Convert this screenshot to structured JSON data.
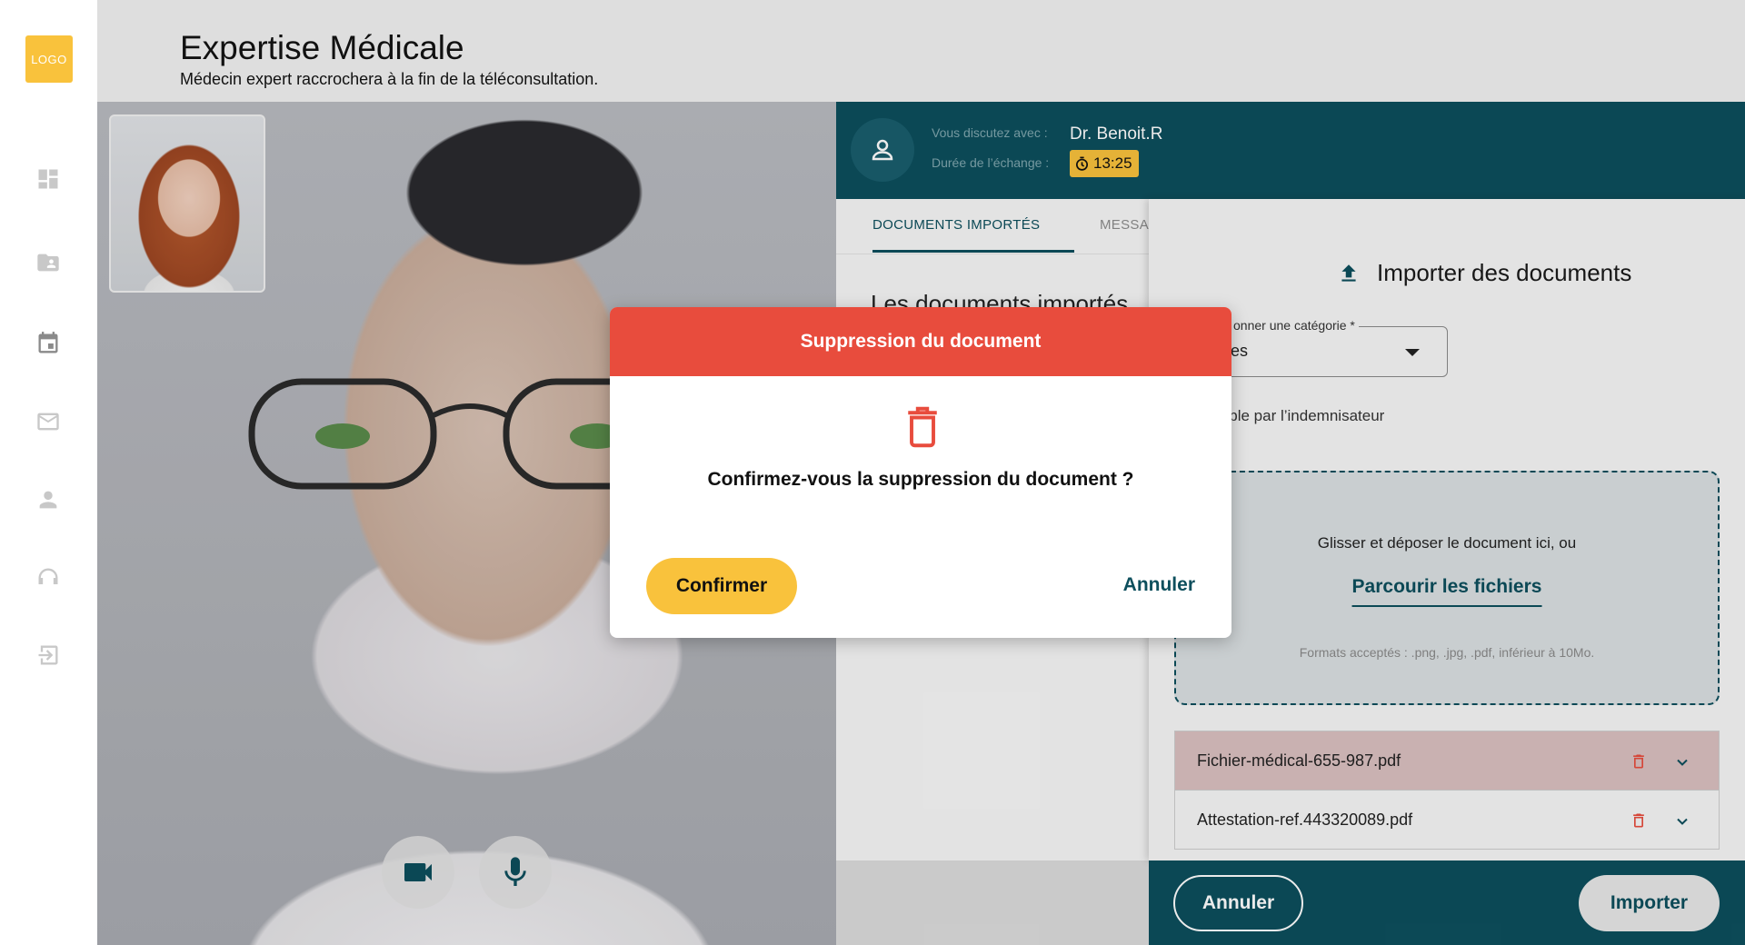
{
  "app": {
    "logo_text": "LOGO",
    "title": "Expertise Médicale",
    "subtitle": "Médecin expert raccrochera à la fin de la téléconsultation."
  },
  "sidebar": {
    "icons": [
      "dashboard-icon",
      "folder-user-icon",
      "calendar-icon",
      "mail-icon",
      "user-icon",
      "support-icon",
      "logout-icon"
    ]
  },
  "call": {
    "label_with": "Vous discutez avec :",
    "doctor_name": "Dr. Benoit.R",
    "label_duration": "Durée de l’échange :",
    "duration": "13:25"
  },
  "tabs": {
    "active": "DOCUMENTS IMPORTÉS",
    "second": "MESSAG"
  },
  "documents": {
    "heading": "Les documents importés"
  },
  "import": {
    "title": "Importer des documents",
    "select_label": "onner une catégorie *",
    "select_value": "es",
    "visible_note": "sible par l’indemnisateur",
    "dropzone_text": "Glisser et déposer le document ici, ou",
    "browse_label": "Parcourir les fichiers",
    "formats": "Formats acceptés : .png, .jpg, .pdf, inférieur à 10Mo.",
    "files": [
      {
        "name": "Fichier-médical-655-987.pdf",
        "selected": true
      },
      {
        "name": "Attestation-ref.443320089.pdf",
        "selected": false
      }
    ],
    "cancel_label": "Annuler",
    "import_label": "Importer"
  },
  "modal": {
    "title": "Suppression du document",
    "question": "Confirmez-vous la suppression du document ?",
    "confirm_label": "Confirmer",
    "cancel_label": "Annuler"
  },
  "colors": {
    "teal": "#0d4f5d",
    "yellow": "#f9c23c",
    "red": "#e84c3d"
  }
}
